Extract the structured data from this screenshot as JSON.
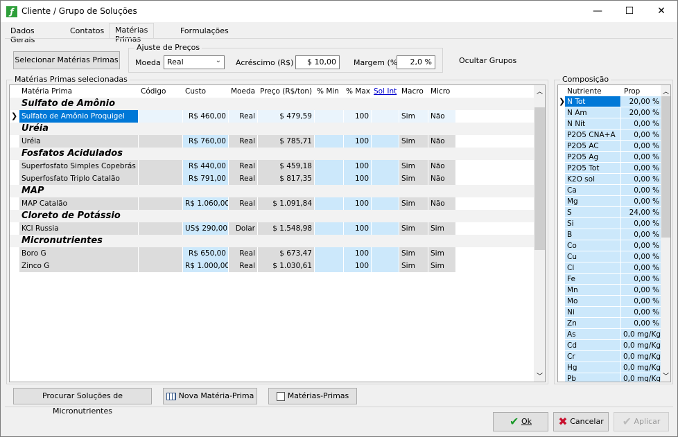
{
  "window": {
    "title": "Cliente / Grupo de Soluções"
  },
  "tabs": [
    "Dados Gerais",
    "Contatos",
    "Matérias Primas",
    "Formulações"
  ],
  "toolbar": {
    "select_button": "Selecionar Matérias Primas",
    "adjust_title": "Ajuste de Preços",
    "moeda_label": "Moeda",
    "moeda_value": "Real",
    "acrescimo_label": "Acréscimo (R$)",
    "acrescimo_value": "$ 10,00",
    "margem_label": "Margem (%)",
    "margem_value": "2,0 %",
    "hide_groups": "Ocultar Grupos"
  },
  "materials": {
    "title": "Matérias Primas selecionadas",
    "columns": [
      "Matéria Prima",
      "Código",
      "Custo",
      "Moeda",
      "Preço (R$/ton)",
      "% Min",
      "% Max",
      "Sol Int",
      "Macro",
      "Micro"
    ],
    "rows": [
      {
        "type": "group",
        "name": "Sulfato de Amônio"
      },
      {
        "type": "item",
        "selected": true,
        "name": "Sulfato de Amônio Proquigel",
        "code": "",
        "cost": "R$ 460,00",
        "currency": "Real",
        "price": "$ 479,59",
        "min": "",
        "max": "100",
        "sol": "",
        "macro": "Sim",
        "micro": "Não"
      },
      {
        "type": "group",
        "name": "Uréia"
      },
      {
        "type": "item",
        "name": "Uréia",
        "code": "",
        "cost": "R$ 760,00",
        "currency": "Real",
        "price": "$ 785,71",
        "min": "",
        "max": "100",
        "sol": "",
        "macro": "Sim",
        "micro": "Não"
      },
      {
        "type": "group",
        "name": "Fosfatos Acidulados"
      },
      {
        "type": "item",
        "name": "Superfosfato Simples Copebrás",
        "code": "",
        "cost": "R$ 440,00",
        "currency": "Real",
        "price": "$ 459,18",
        "min": "",
        "max": "100",
        "sol": "",
        "macro": "Sim",
        "micro": "Não"
      },
      {
        "type": "item",
        "name": "Superfosfato Triplo Catalão",
        "code": "",
        "cost": "R$ 791,00",
        "currency": "Real",
        "price": "$ 817,35",
        "min": "",
        "max": "100",
        "sol": "",
        "macro": "Sim",
        "micro": "Não"
      },
      {
        "type": "group",
        "name": "MAP"
      },
      {
        "type": "item",
        "name": "MAP Catalão",
        "code": "",
        "cost": "R$ 1.060,00",
        "currency": "Real",
        "price": "$ 1.091,84",
        "min": "",
        "max": "100",
        "sol": "",
        "macro": "Sim",
        "micro": "Não"
      },
      {
        "type": "group",
        "name": "Cloreto de Potássio"
      },
      {
        "type": "item",
        "name": "KCl Russia",
        "code": "",
        "cost": "US$ 290,00",
        "currency": "Dolar",
        "price": "$ 1.548,98",
        "min": "",
        "max": "100",
        "sol": "",
        "macro": "Sim",
        "micro": "Sim"
      },
      {
        "type": "group",
        "name": "Micronutrientes"
      },
      {
        "type": "item",
        "name": "Boro G",
        "code": "",
        "cost": "R$ 650,00",
        "currency": "Real",
        "price": "$ 673,47",
        "min": "",
        "max": "100",
        "sol": "",
        "macro": "Sim",
        "micro": "Sim"
      },
      {
        "type": "item",
        "name": "Zinco G",
        "code": "",
        "cost": "R$ 1.000,00",
        "currency": "Real",
        "price": "$ 1.030,61",
        "min": "",
        "max": "100",
        "sol": "",
        "macro": "Sim",
        "micro": "Sim"
      }
    ]
  },
  "composition": {
    "title": "Composição",
    "columns": [
      "Nutriente",
      "Prop"
    ],
    "rows": [
      [
        "N Tot",
        "20,00 %"
      ],
      [
        "N Am",
        "20,00 %"
      ],
      [
        "N Nít",
        "0,00 %"
      ],
      [
        "P2O5 CNA+A",
        "0,00 %"
      ],
      [
        "P2O5 AC",
        "0,00 %"
      ],
      [
        "P2O5 Ag",
        "0,00 %"
      ],
      [
        "P2O5 Tot",
        "0,00 %"
      ],
      [
        "K2O sol",
        "0,00 %"
      ],
      [
        "Ca",
        "0,00 %"
      ],
      [
        "Mg",
        "0,00 %"
      ],
      [
        "S",
        "24,00 %"
      ],
      [
        "Si",
        "0,00 %"
      ],
      [
        "B",
        "0,00 %"
      ],
      [
        "Co",
        "0,00 %"
      ],
      [
        "Cu",
        "0,00 %"
      ],
      [
        "Cl",
        "0,00 %"
      ],
      [
        "Fe",
        "0,00 %"
      ],
      [
        "Mn",
        "0,00 %"
      ],
      [
        "Mo",
        "0,00 %"
      ],
      [
        "Ni",
        "0,00 %"
      ],
      [
        "Zn",
        "0,00 %"
      ],
      [
        "As",
        "0,0 mg/Kg"
      ],
      [
        "Cd",
        "0,0 mg/Kg"
      ],
      [
        "Cr",
        "0,0 mg/Kg"
      ],
      [
        "Hg",
        "0,0 mg/Kg"
      ],
      [
        "Pb",
        "0,0 mg/Kg"
      ]
    ]
  },
  "bottom_buttons": {
    "micronutrients": "Procurar Soluções de Micronutrientes",
    "new_material": "Nova Matéria-Prima",
    "materials": "Matérias-Primas"
  },
  "footer": {
    "ok": "Ok",
    "cancel": "Cancelar",
    "apply": "Aplicar"
  },
  "colors": {
    "selection": "#0078d7",
    "light_blue": "#cce8fb",
    "header_gray": "#d9d9d9"
  }
}
